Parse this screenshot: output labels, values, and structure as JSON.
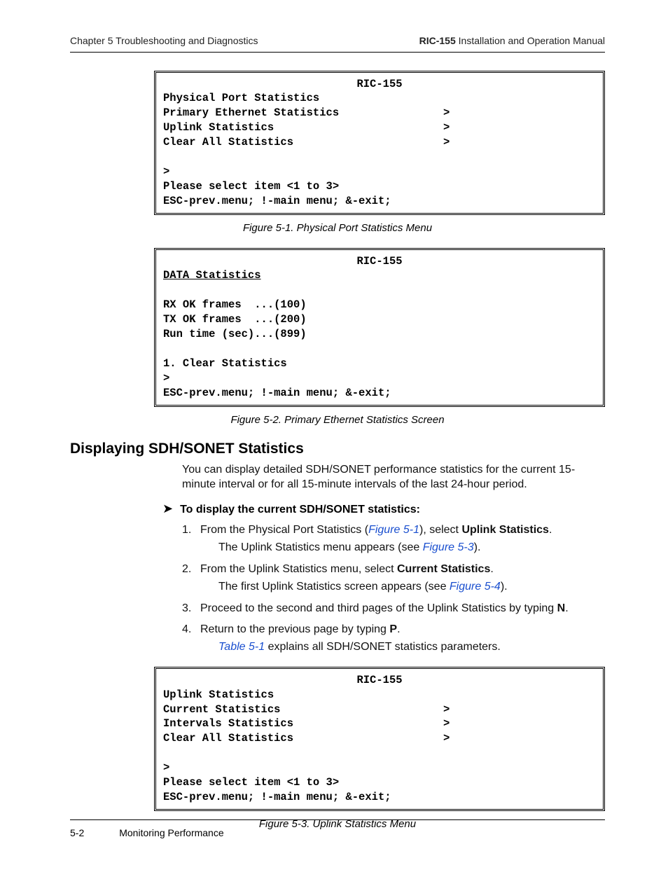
{
  "runhead": {
    "left": "Chapter 5  Troubleshooting and Diagnostics",
    "right_bold": "RIC-155",
    "right_rest": " Installation and Operation Manual"
  },
  "term1": {
    "title": "RIC-155",
    "l1": "Physical Port Statistics",
    "l2a": "Primary Ethernet Statistics",
    "l2b": ">",
    "l3a": "Uplink Statistics",
    "l3b": ">",
    "l4a": "Clear All Statistics",
    "l4b": ">",
    "l5": ">",
    "l6": "Please select item <1 to 3>",
    "l7": "ESC-prev.menu; !-main menu; &-exit;"
  },
  "cap1": "Figure 5-1.  Physical Port Statistics Menu",
  "term2": {
    "title": "RIC-155",
    "hdr": "DATA Statistics",
    "r1": "RX OK frames  ...(100)",
    "r2": "TX OK frames  ...(200)",
    "r3": "Run time (sec)...(899)",
    "r4": "1. Clear Statistics",
    "r5": ">",
    "r6": "ESC-prev.menu; !-main menu; &-exit;"
  },
  "cap2": "Figure 5-2.  Primary Ethernet Statistics Screen",
  "section_title": "Displaying SDH/SONET Statistics",
  "para1": "You can display detailed SDH/SONET performance statistics for the current 15-minute interval or for all 15-minute intervals of the last 24-hour period.",
  "lead": "To display the current SDH/SONET statistics:",
  "steps": {
    "s1a": "From the Physical Port Statistics (",
    "s1link": "Figure 5-1",
    "s1b": "), select ",
    "s1bold": "Uplink Statistics",
    "s1c": ".",
    "s1sub_a": "The Uplink Statistics menu appears (see ",
    "s1sub_link": "Figure 5-3",
    "s1sub_b": ").",
    "s2a": "From the Uplink Statistics menu, select ",
    "s2bold": "Current Statistics",
    "s2b": ".",
    "s2sub_a": "The first Uplink Statistics screen appears (see ",
    "s2sub_link": "Figure 5-4",
    "s2sub_b": ").",
    "s3a": "Proceed to the second and third pages of the Uplink Statistics by typing ",
    "s3bold": "N",
    "s3b": ".",
    "s4a": "Return to the previous page by typing ",
    "s4bold": "P",
    "s4b": ".",
    "s4sub_link": "Table 5-1",
    "s4sub_rest": " explains all SDH/SONET statistics parameters."
  },
  "term3": {
    "title": "RIC-155",
    "l1": "Uplink Statistics",
    "l2a": "Current Statistics",
    "l2b": ">",
    "l3a": "Intervals Statistics",
    "l3b": ">",
    "l4a": "Clear All Statistics",
    "l4b": ">",
    "l5": ">",
    "l6": "Please select item <1 to 3>",
    "l7": "ESC-prev.menu; !-main menu; &-exit;"
  },
  "cap3": "Figure 5-3.  Uplink Statistics Menu",
  "footer": {
    "page": "5-2",
    "section": "Monitoring Performance"
  }
}
